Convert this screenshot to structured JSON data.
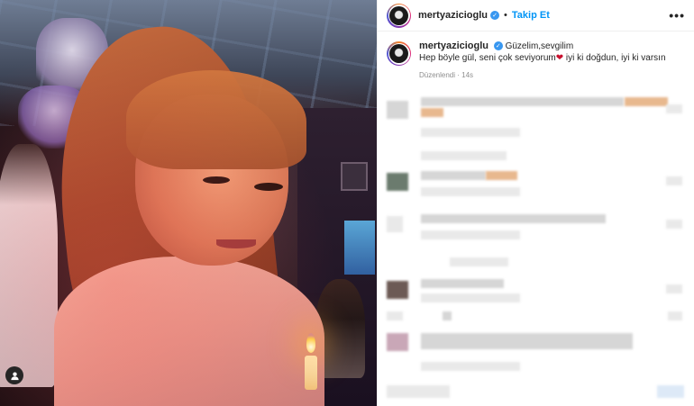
{
  "post": {
    "username": "mertyazicioglu",
    "follow_label": "Takip Et",
    "separator": "•",
    "more_label": "•••",
    "verified_mark": "✓",
    "caption": {
      "line1": "Güzelim,sevgilim",
      "line2_before_heart": "Hep böyle gül, seni çok seviyorum",
      "heart": "❤",
      "line2_after_heart": " iyi ki doğdun, iyi ki varsın",
      "meta": "Düzenlendi · 14s"
    }
  },
  "icons": {
    "verified": "verified-badge-icon",
    "more": "more-options-icon",
    "tag": "user-tag-icon",
    "heart": "heart-emoji-icon"
  },
  "colors": {
    "link": "#0095f6",
    "verified": "#3897f0",
    "meta": "#8e8e8e",
    "text": "#262626"
  }
}
